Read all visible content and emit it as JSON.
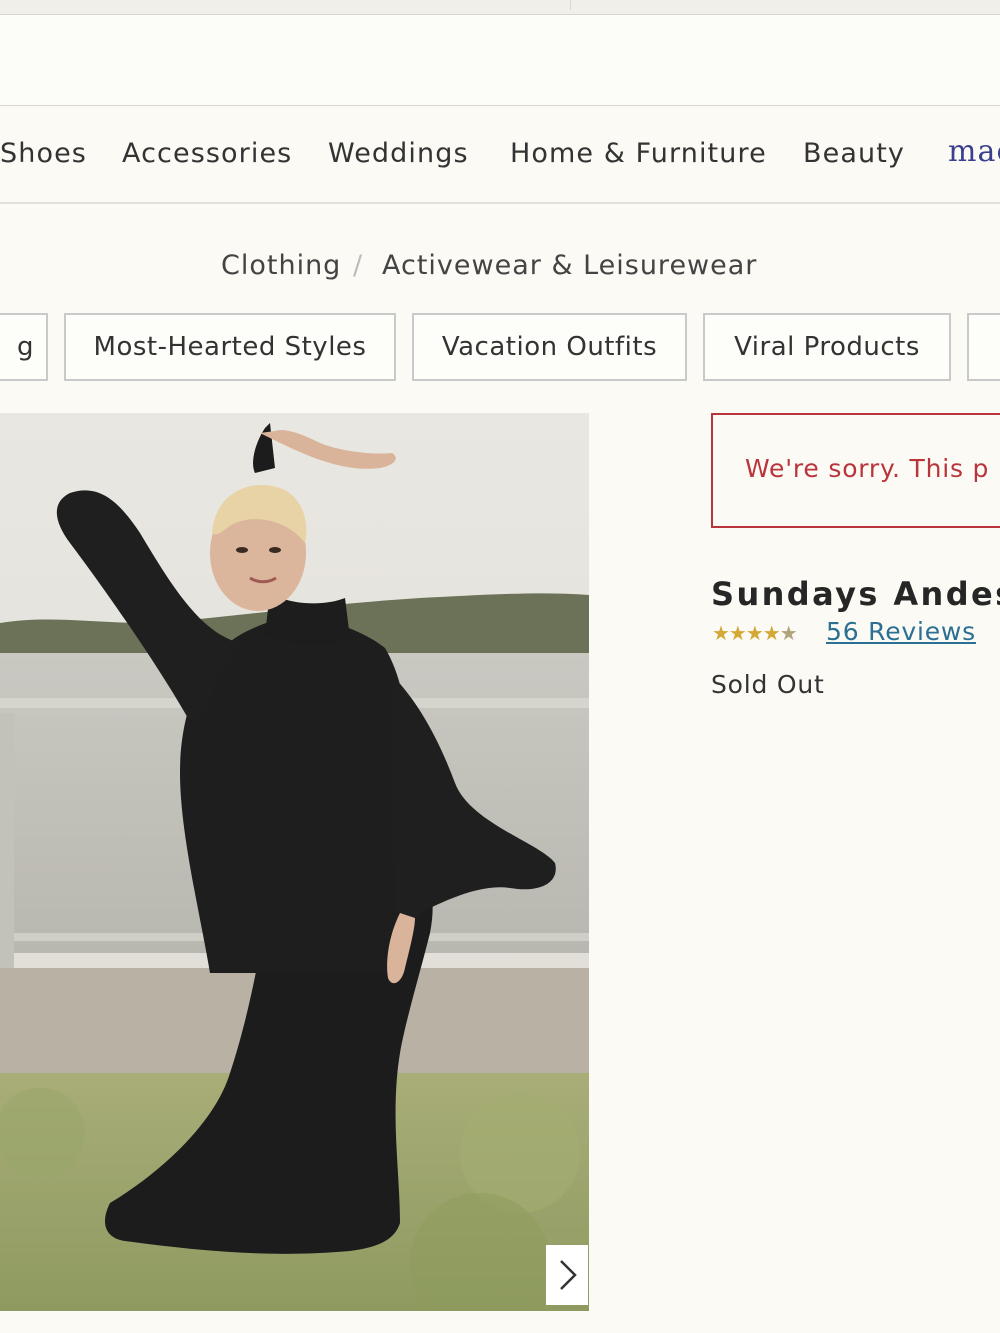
{
  "nav": {
    "items": [
      "Shoes",
      "Accessories",
      "Weddings",
      "Home & Furniture",
      "Beauty"
    ],
    "brand_partial": "mae"
  },
  "breadcrumb": {
    "items": [
      "Clothing",
      "Activewear & Leisurewear"
    ],
    "separator": "/"
  },
  "chips": [
    "g",
    "Most-Hearted Styles",
    "Vacation Outfits",
    "Viral Products",
    ""
  ],
  "alert": {
    "text": "We're sorry. This p",
    "color": "#b9353b"
  },
  "product": {
    "title": "Sundays Andes",
    "rating": 4.5,
    "stars_full": "★★★★",
    "stars_half": "★",
    "reviews_label": "56 Reviews",
    "availability": "Sold Out"
  },
  "gallery": {
    "next_icon": "chevron-right-icon"
  }
}
